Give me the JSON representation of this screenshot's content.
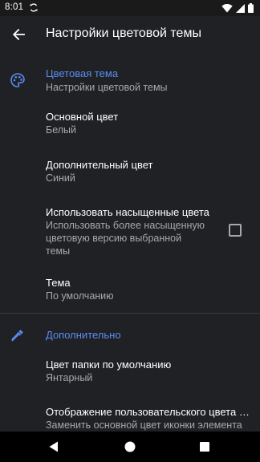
{
  "status_bar": {
    "time": "8:01",
    "icons": [
      "sync-icon",
      "wifi-icon",
      "cellular-icon",
      "battery-icon"
    ]
  },
  "app_bar": {
    "back_icon": "arrow-back-icon",
    "title": "Настройки цветовой темы"
  },
  "sections": {
    "color_theme": {
      "icon": "palette-icon",
      "header": "Цветовая тема",
      "subtitle": "Настройки цветовой темы",
      "items": [
        {
          "title": "Основной цвет",
          "summary": "Белый"
        },
        {
          "title": "Дополнительный цвет",
          "summary": "Синий"
        },
        {
          "title": "Использовать насыщенные цвета",
          "summary_lines": [
            "Использовать более насыщенную",
            "цветовую версию выбранной",
            "темы"
          ],
          "checked": false
        },
        {
          "title": "Тема",
          "summary": "По умолчанию"
        }
      ]
    },
    "advanced": {
      "icon": "eyedropper-icon",
      "header": "Дополнительно",
      "items": [
        {
          "title": "Цвет папки по умолчанию",
          "summary": "Янтарный"
        },
        {
          "title": "Отображение пользовательского цвета э...",
          "summary": "Заменить основной цвет иконки элемента"
        }
      ]
    }
  },
  "colors": {
    "background": "#202124",
    "accent": "#5a8df3",
    "text_primary": "#ffffff",
    "text_secondary": "#a6a8ab",
    "divider": "#3a3b3e"
  },
  "nav_bar": {
    "icons": [
      "back-triangle-icon",
      "home-circle-icon",
      "recents-square-icon"
    ]
  }
}
